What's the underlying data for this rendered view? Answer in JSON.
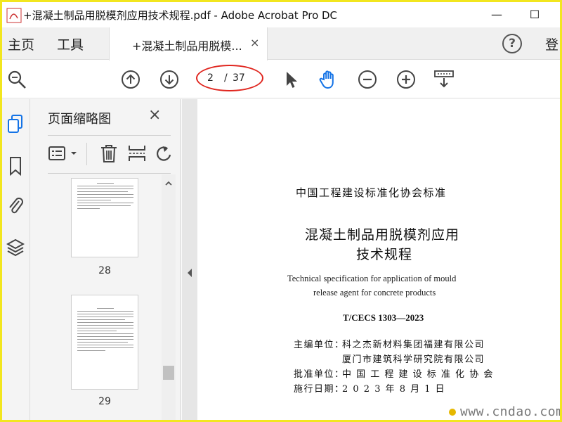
{
  "window": {
    "title": "+混凝土制品用脱模剂应用技术规程.pdf - Adobe Acrobat Pro DC",
    "minimize": "—",
    "maximize": "☐"
  },
  "tabs": {
    "home": "主页",
    "tools": "工具",
    "document_tab": "+混凝土制品用脱模...",
    "close": "×",
    "help": "?",
    "login": "登"
  },
  "toolbar": {
    "page_current": "2",
    "page_sep": "/",
    "page_total": "37"
  },
  "panel": {
    "title": "页面缩略图",
    "close": "×",
    "thumbnails": [
      {
        "label": "28"
      },
      {
        "label": "29"
      }
    ]
  },
  "document": {
    "header": "中国工程建设标准化协会标准",
    "title_line1": "混凝土制品用脱模剂应用",
    "title_line2": "技术规程",
    "english_line1": "Technical specification for application of mould",
    "english_line2": "release agent for concrete products",
    "code": "T/CECS 1303—2023",
    "editor_label": "主编单位：",
    "editor_1": "科之杰新材料集团福建有限公司",
    "editor_2": "厦门市建筑科学研究院有限公司",
    "approver_label": "批准单位：",
    "approver": "中 国 工 程 建 设 标 准 化 协 会",
    "date_label": "施行日期：",
    "date": "2 0 2 3  年  8  月  1  日"
  },
  "watermark": {
    "text": "www.cndao.com"
  },
  "colors": {
    "accent_blue": "#1473e6",
    "annotation_red": "#e0261f",
    "frame_yellow": "#f2e61f"
  }
}
